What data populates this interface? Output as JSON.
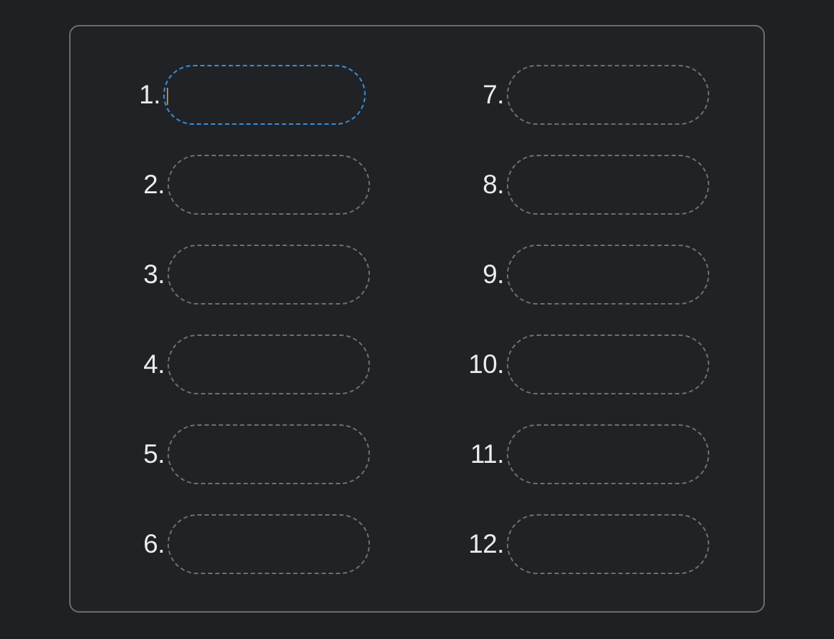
{
  "slots": [
    {
      "number": "1.",
      "value": "",
      "active": true
    },
    {
      "number": "2.",
      "value": ""
    },
    {
      "number": "3.",
      "value": ""
    },
    {
      "number": "4.",
      "value": ""
    },
    {
      "number": "5.",
      "value": ""
    },
    {
      "number": "6.",
      "value": ""
    },
    {
      "number": "7.",
      "value": ""
    },
    {
      "number": "8.",
      "value": ""
    },
    {
      "number": "9.",
      "value": ""
    },
    {
      "number": "10.",
      "value": ""
    },
    {
      "number": "11.",
      "value": ""
    },
    {
      "number": "12.",
      "value": ""
    }
  ],
  "colors": {
    "background": "#1f2024",
    "panel_border": "#6b6c70",
    "slot_border": "#6e6f73",
    "active_border": "#3a8fd6",
    "number_text": "#ececec"
  }
}
